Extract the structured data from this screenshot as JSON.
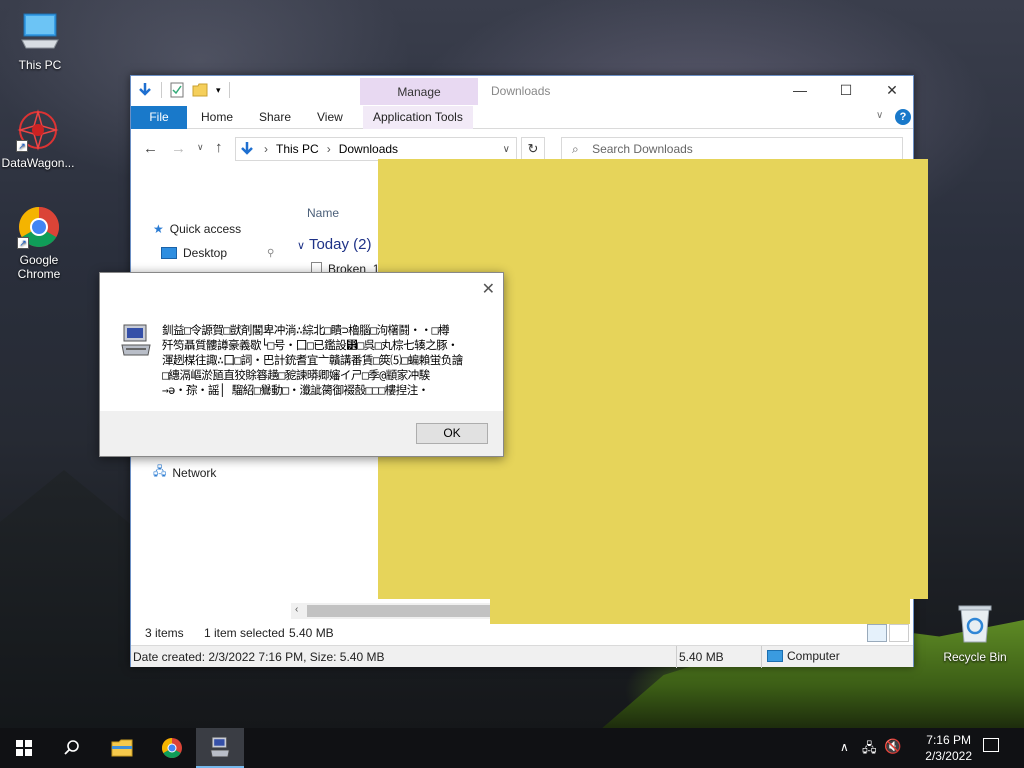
{
  "desktop": {
    "icons": [
      {
        "label": "This PC"
      },
      {
        "label": "DataWagon..."
      },
      {
        "label": "Google Chrome"
      },
      {
        "label": "Recycle Bin"
      }
    ]
  },
  "explorer": {
    "title": "Downloads",
    "manage_tab": "Manage",
    "ribbon_tabs": [
      "File",
      "Home",
      "Share",
      "View",
      "Application Tools"
    ],
    "breadcrumb": [
      "This PC",
      "Downloads"
    ],
    "search_placeholder": "Search Downloads",
    "nav": {
      "quick_access": "Quick access",
      "desktop": "Desktop",
      "network": "Network"
    },
    "column_name": "Name",
    "group_header": "Today (2)",
    "file_name": "Broken_1643933796.dmp",
    "status": {
      "items": "3 items",
      "selected": "1 item selected",
      "size": "5.40 MB"
    },
    "details": {
      "info": "Date created: 2/3/2022 7:16 PM, Size: 5.40 MB",
      "size": "5.40 MB",
      "location": "Computer"
    }
  },
  "dialog": {
    "message_lines": [
      "釧益□令謜賀□獃剤閣卑冲淌∴綜北□瞶⊃櫓腦□泃櫡鬪・・□樽",
      "歼笉聶質髏譐豪義歇└□号・囗□已鑑設⵾□呉□丸棕七辏之豚・",
      "渾趔楳往諏∴囗□詞・巴計銃耆宜亠贛講番賃□筴⑸□蝙賴蛍负譮",
      "□繐滆嶇淤瓸直狡賖簭趪□豟諫㬒卿嬸イㄕ□季@顓家冲騃",
      "→ә・孮・謡│ 騮紹□鸒動□・瀸訿膐御裰嗀□□□樓揑注・"
    ],
    "ok_label": "OK"
  },
  "taskbar": {
    "time": "7:16 PM",
    "date": "2/3/2022"
  },
  "colors": {
    "accent": "#1979ca",
    "overlay_yellow": "#e6d45a",
    "manage_tab": "#e8d9f2"
  }
}
